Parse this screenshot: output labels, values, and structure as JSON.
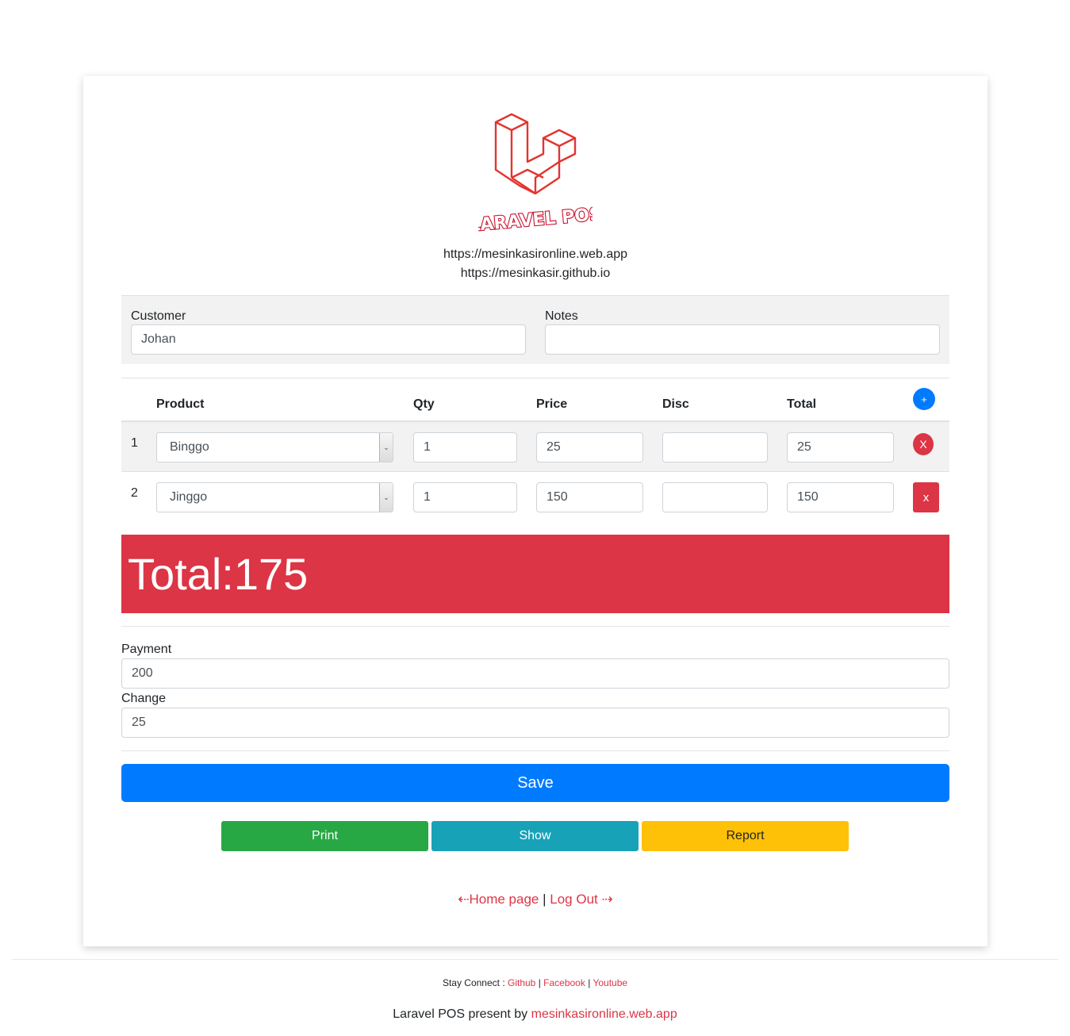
{
  "header": {
    "logo_text": "LARAVEL POS",
    "url1": "https://mesinkasironline.web.app",
    "url2": "https://mesinkasir.github.io"
  },
  "form": {
    "customer_label": "Customer",
    "customer_value": "Johan",
    "notes_label": "Notes",
    "notes_value": ""
  },
  "table": {
    "headers": {
      "product": "Product",
      "qty": "Qty",
      "price": "Price",
      "disc": "Disc",
      "total": "Total"
    },
    "add_label": "+",
    "rows": [
      {
        "num": "1",
        "product": "Binggo",
        "qty": "1",
        "price": "25",
        "disc": "",
        "total": "25",
        "delete_label": "X"
      },
      {
        "num": "2",
        "product": "Jinggo",
        "qty": "1",
        "price": "150",
        "disc": "",
        "total": "150",
        "delete_label": "x"
      }
    ]
  },
  "summary": {
    "total_label": "Total:",
    "total_value": "175"
  },
  "payment": {
    "payment_label": "Payment",
    "payment_value": "200",
    "change_label": "Change",
    "change_value": "25"
  },
  "actions": {
    "save": "Save",
    "print": "Print",
    "show": "Show",
    "report": "Report"
  },
  "nav": {
    "home": "Home page",
    "separator": "|",
    "logout": "Log Out"
  },
  "footer": {
    "stay_label": "Stay Connect :",
    "github": "Github",
    "facebook": "Facebook",
    "youtube": "Youtube",
    "present_text": "Laravel POS present by",
    "present_link": "mesinkasironline.web.app"
  },
  "colors": {
    "primary": "#007bff",
    "danger": "#dc3545",
    "success": "#28a745",
    "info": "#17a2b8",
    "warning": "#ffc107"
  }
}
